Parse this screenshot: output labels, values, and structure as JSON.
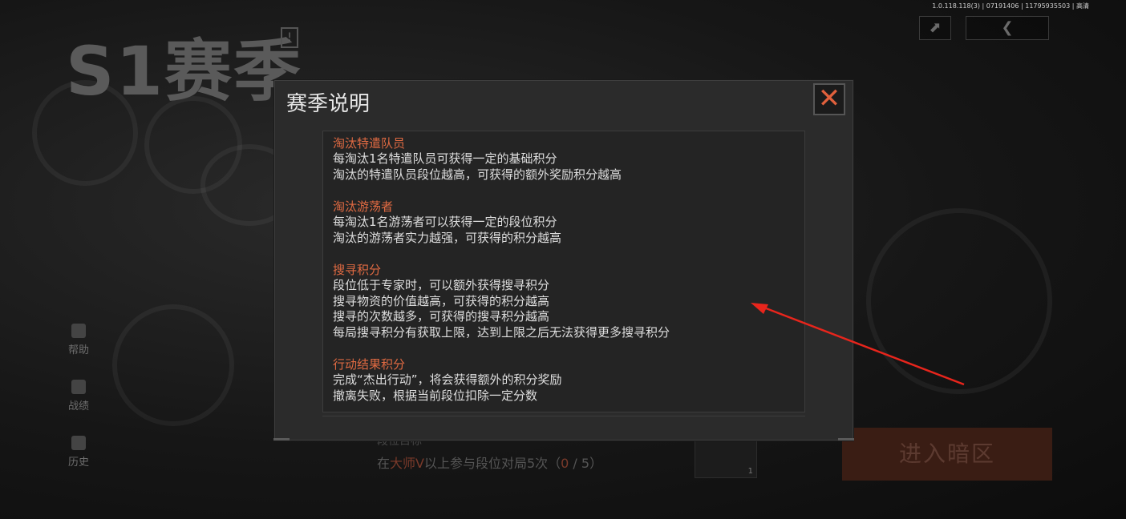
{
  "background": {
    "season_title": "S1赛季",
    "season_alert_icon": "!",
    "version": "1.0.118.118(3) | 07191406 | 11795935503 | 高清",
    "top_buttons": [
      "⬈",
      "❮"
    ],
    "sidebar": [
      {
        "label": "帮助",
        "icon": "help-icon"
      },
      {
        "label": "战绩",
        "icon": "record-icon"
      },
      {
        "label": "历史",
        "icon": "history-icon"
      }
    ],
    "goal_top": "段位目标",
    "goal": {
      "prefix": "在",
      "highlight": "大师V",
      "suffix": "以上参与段位对局5次（",
      "progress": "0",
      "sep": " / ",
      "total": "5",
      "close": "）"
    },
    "item_count": "1",
    "enter_button": "进入暗区"
  },
  "modal": {
    "title": "赛季说明",
    "close_icon": "✕",
    "sections": [
      {
        "heading": "淘汰特遣队员",
        "lines": [
          "每淘汰1名特遣队员可获得一定的基础积分",
          "淘汰的特遣队员段位越高，可获得的额外奖励积分越高"
        ]
      },
      {
        "heading": "淘汰游荡者",
        "lines": [
          "每淘汰1名游荡者可以获得一定的段位积分",
          "淘汰的游荡者实力越强，可获得的积分越高"
        ]
      },
      {
        "heading": "搜寻积分",
        "lines": [
          "段位低于专家时，可以额外获得搜寻积分",
          "搜寻物资的价值越高，可获得的积分越高",
          "搜寻的次数越多，可获得的搜寻积分越高",
          "每局搜寻积分有获取上限，达到上限之后无法获得更多搜寻积分"
        ]
      },
      {
        "heading": "行动结果积分",
        "lines": [
          "完成“杰出行动”，将会获得额外的积分奖励",
          "撤离失败，根据当前段位扣除一定分数"
        ]
      }
    ]
  },
  "annotation": {
    "color": "#e8251c"
  }
}
